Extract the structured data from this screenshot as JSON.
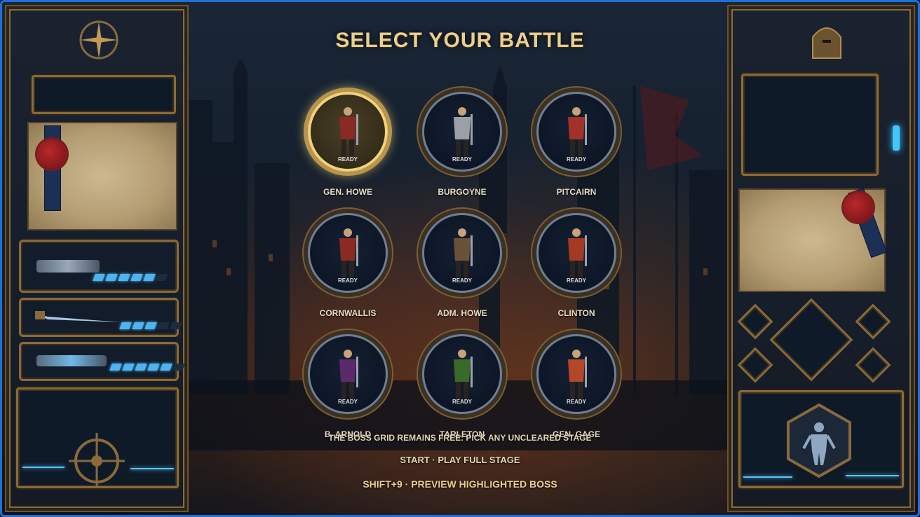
{
  "screen": {
    "title": "SELECT YOUR BATTLE"
  },
  "bosses": [
    {
      "name": "GEN. HOWE",
      "status": "READY",
      "selected": true,
      "color": "#8a2a22"
    },
    {
      "name": "BURGOYNE",
      "status": "READY",
      "selected": false,
      "color": "#9aa0a8"
    },
    {
      "name": "PITCAIRN",
      "status": "READY",
      "selected": false,
      "color": "#a3312a"
    },
    {
      "name": "CORNWALLIS",
      "status": "READY",
      "selected": false,
      "color": "#8a2a22"
    },
    {
      "name": "ADM. HOWE",
      "status": "READY",
      "selected": false,
      "color": "#6a5238"
    },
    {
      "name": "CLINTON",
      "status": "READY",
      "selected": false,
      "color": "#a33a22"
    },
    {
      "name": "B. ARNOLD",
      "status": "READY",
      "selected": false,
      "color": "#5a2a6a"
    },
    {
      "name": "TARLETON",
      "status": "READY",
      "selected": false,
      "color": "#3a6a2a"
    },
    {
      "name": "GEN. GAGE",
      "status": "READY",
      "selected": false,
      "color": "#b4462a"
    }
  ],
  "footer": {
    "hint": "THE BOSS GRID REMAINS FREE: PICK ANY UNCLEARED STAGE",
    "start": "START · PLAY FULL STAGE",
    "preview": "SHIFT+9 · PREVIEW HIGHLIGHTED BOSS"
  },
  "weapons": [
    {
      "icon": "cannon-icon",
      "energy": 0.8
    },
    {
      "icon": "saber-icon",
      "energy": 0.6
    },
    {
      "icon": "tesla-gun-icon",
      "energy": 0.8
    }
  ],
  "colors": {
    "accent": "#e9cf92",
    "brass": "#8a6a3a",
    "energy": "#4fb3ef",
    "selection": "#f0d27a",
    "frame": "#1f6fd6"
  }
}
